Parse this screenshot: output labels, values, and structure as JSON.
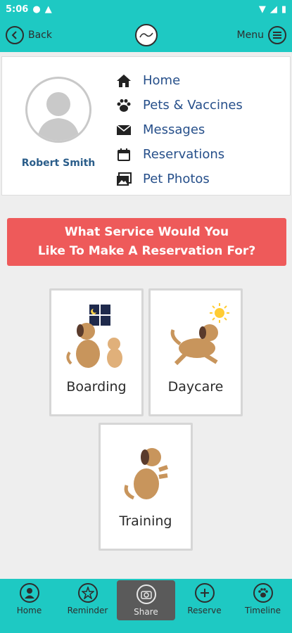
{
  "status_bar": {
    "time": "5:06"
  },
  "header": {
    "back_label": "Back",
    "menu_label": "Menu",
    "logo_text": ""
  },
  "profile": {
    "name": "Robert Smith"
  },
  "nav": [
    {
      "label": "Home",
      "icon": "home-icon"
    },
    {
      "label": "Pets & Vaccines",
      "icon": "paw-icon"
    },
    {
      "label": "Messages",
      "icon": "mail-icon"
    },
    {
      "label": "Reservations",
      "icon": "calendar-icon"
    },
    {
      "label": "Pet Photos",
      "icon": "photos-icon"
    }
  ],
  "banner": {
    "line1": "What Service Would You",
    "line2": "Like To Make A Reservation For?"
  },
  "services": [
    {
      "label": "Boarding"
    },
    {
      "label": "Daycare"
    },
    {
      "label": "Training"
    }
  ],
  "bottom_nav": [
    {
      "label": "Home"
    },
    {
      "label": "Reminder"
    },
    {
      "label": "Share"
    },
    {
      "label": "Reserve"
    },
    {
      "label": "Timeline"
    }
  ],
  "colors": {
    "accent": "#1ec9c3",
    "banner": "#ee5a5a",
    "nav_text": "#264f8a"
  }
}
